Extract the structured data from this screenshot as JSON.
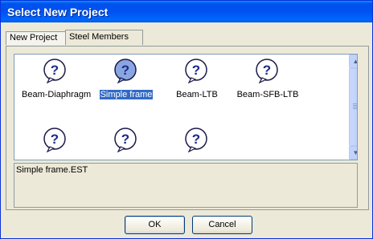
{
  "window": {
    "title": "Select New Project"
  },
  "tabs": [
    {
      "label": "New Project",
      "active": false
    },
    {
      "label": "Steel Members",
      "active": true
    }
  ],
  "items": [
    {
      "label": "Beam-Diaphragm",
      "icon": "question-icon",
      "selected": false
    },
    {
      "label": "Simple frame",
      "icon": "question-icon",
      "selected": true
    },
    {
      "label": "Beam-LTB",
      "icon": "question-icon",
      "selected": false
    },
    {
      "label": "Beam-SFB-LTB",
      "icon": "question-icon",
      "selected": false
    },
    {
      "label": "",
      "icon": "question-icon",
      "selected": false
    },
    {
      "label": "",
      "icon": "question-icon",
      "selected": false
    },
    {
      "label": "",
      "icon": "question-icon",
      "selected": false
    }
  ],
  "description": "Simple frame.EST",
  "buttons": {
    "ok": "OK",
    "cancel": "Cancel"
  },
  "colors": {
    "title_bar": "#0058ee",
    "selection": "#316ac5",
    "dialog_bg": "#ece9d8"
  }
}
